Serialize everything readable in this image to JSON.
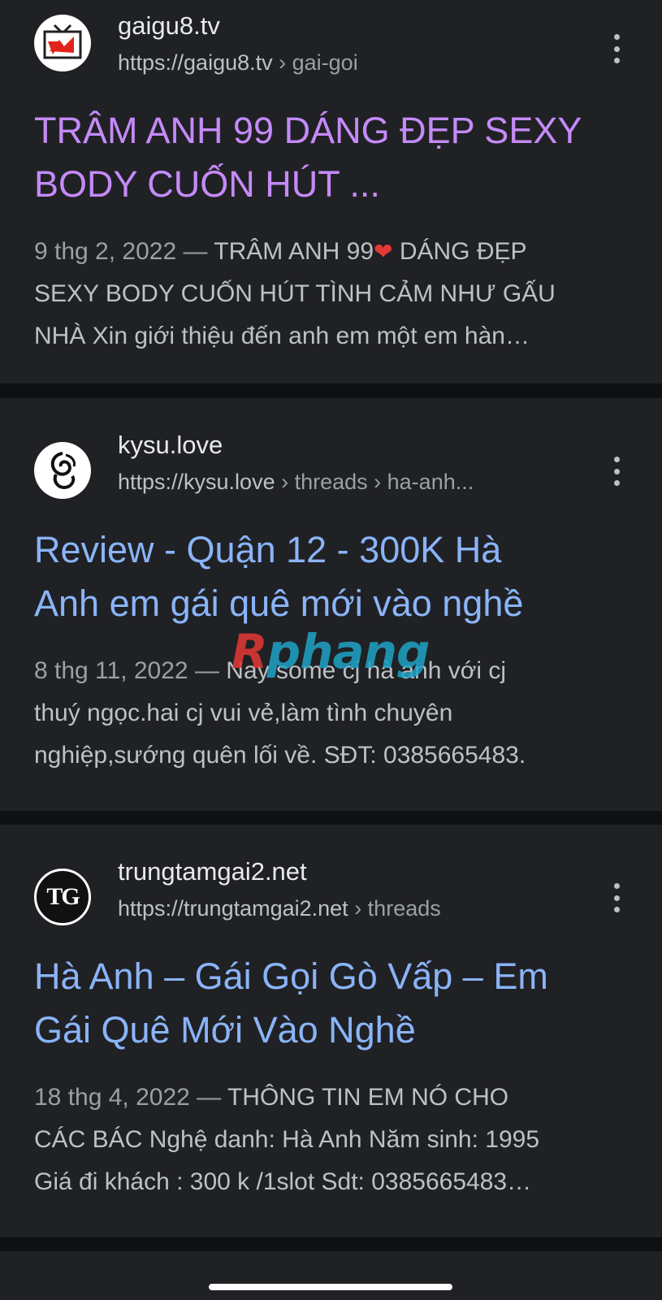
{
  "results": [
    {
      "site_name": "gaigu8.tv",
      "url_base": "https://gaigu8.tv",
      "url_path": "› gai-goi",
      "title_line1": "TRÂM ANH 99 DÁNG ĐẸP SEXY",
      "title_line2": "BODY CUỐN HÚT ...",
      "date": "9 thg 2, 2022 —",
      "snippet_line1_text": " TRÂM ANH 99",
      "heart": "❤",
      "snippet_line1_rest": " DÁNG ĐẸP",
      "snippet_line2": "SEXY BODY CUỐN HÚT TÌNH CẢM NHƯ GẤU",
      "snippet_line3": "NHÀ Xin giới thiệu đến anh em một em hàn…",
      "visited": true,
      "icon": "tv-logo-icon"
    },
    {
      "site_name": "kysu.love",
      "url_base": "https://kysu.love",
      "url_path": "› threads › ha-anh...",
      "title_line1": "Review - Quận 12 - 300K Hà",
      "title_line2": "Anh em gái quê mới vào nghề",
      "date": "8 thg 11, 2022 —",
      "snippet_line1_text": " Nay some cj hà anh với cj",
      "snippet_line2": "thuý ngọc.hai cj vui vẻ,làm tình chuyên",
      "snippet_line3": "nghiệp,sướng quên lối về. SĐT: 0385665483.",
      "visited": false,
      "icon": "swirl-logo-icon"
    },
    {
      "site_name": "trungtamgai2.net",
      "url_base": "https://trungtamgai2.net",
      "url_path": "› threads",
      "title_line1": "Hà Anh – Gái Gọi Gò Vấp – Em",
      "title_line2": "Gái Quê Mới Vào Nghề",
      "date": "18 thg 4, 2022 —",
      "snippet_line1_text": " THÔNG TIN EM NÓ CHO",
      "snippet_line2": "CÁC BÁC Nghệ danh: Hà Anh Năm sinh: 1995",
      "snippet_line3": "Giá đi khách : 300 k /1slot Sdt: 0385665483…",
      "visited": false,
      "icon": "tg-logo-icon",
      "favicon_text": "TG"
    }
  ],
  "watermark": {
    "first": "R",
    "rest": "phang"
  },
  "colors": {
    "background": "#202124",
    "visited_link": "#c58af9",
    "link": "#8ab4f8",
    "snippet": "#bdc1c6"
  }
}
